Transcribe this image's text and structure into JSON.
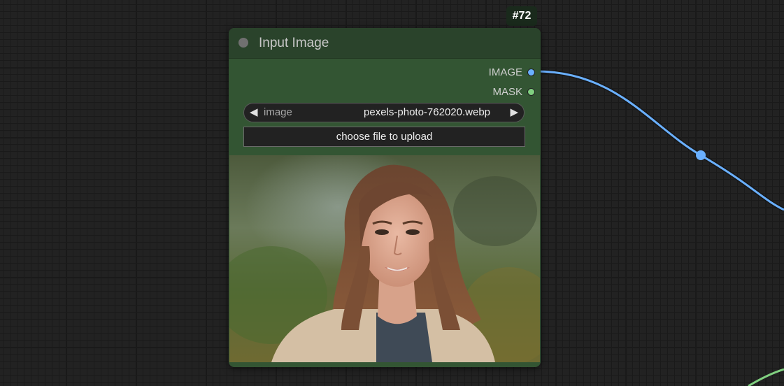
{
  "node": {
    "id_badge": "#72",
    "title": "Input Image",
    "outputs": [
      {
        "label": "IMAGE",
        "color": "#6ab0ff"
      },
      {
        "label": "MASK",
        "color": "#80d080"
      }
    ],
    "combo": {
      "name": "image",
      "value": "pexels-photo-762020.webp",
      "left_arrow": "◀",
      "right_arrow": "▶"
    },
    "upload_label": "choose file to upload",
    "preview_icon": "portrait-photo"
  },
  "colors": {
    "node_body": "#335533",
    "node_title": "#2a432b",
    "canvas_bg": "#222222",
    "image_link": "#6ab0ff",
    "mask_link": "#80d080"
  }
}
